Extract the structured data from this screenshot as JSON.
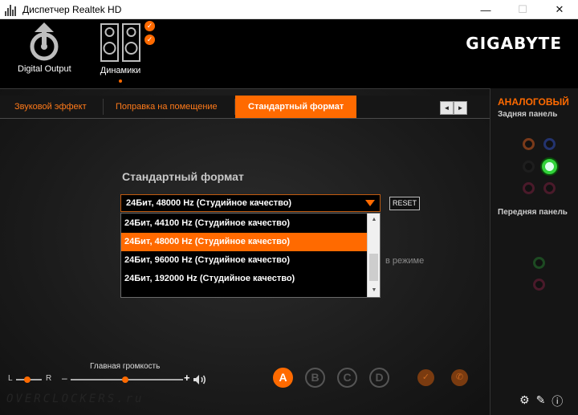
{
  "window": {
    "title": "Диспетчер Realtek HD",
    "minimize": "—",
    "maximize": "☐",
    "close": "✕"
  },
  "header": {
    "devices": [
      {
        "label": "Digital Output",
        "icon": "digital-output-icon"
      },
      {
        "label": "Динамики",
        "icon": "speakers-icon",
        "active": true
      }
    ],
    "brand": "GIGABYTE",
    "badges": [
      "✓",
      "✓"
    ]
  },
  "tabs": [
    {
      "label": "Звуковой эффект"
    },
    {
      "label": "Поправка на помещение"
    },
    {
      "label": "Стандартный формат",
      "active": true
    }
  ],
  "tab_scroll": {
    "left": "◄",
    "right": "►"
  },
  "format": {
    "title": "Стандартный формат",
    "selected": "24Бит, 48000 Hz (Студийное качество)",
    "reset_label": "RESET",
    "options": [
      "24Бит, 44100 Hz (Студийное качество)",
      "24Бит, 48000 Hz (Студийное качество)",
      "24Бит, 96000 Hz (Студийное качество)",
      "24Бит, 192000 Hz (Студийное качество)"
    ],
    "behind_text": "в режиме",
    "scroll_up": "▲",
    "scroll_down": "▼"
  },
  "volume": {
    "title": "Главная громкость",
    "left": "L",
    "right": "R",
    "minus": "–",
    "plus": "+",
    "balance": 0.5,
    "level": 0.5
  },
  "profiles": [
    "A",
    "B",
    "C",
    "D"
  ],
  "active_profile": "A",
  "watermark": "OVERCLOCKERS.ru",
  "right_panel": {
    "title": "АНАЛОГОВЫЙ",
    "rear": "Задняя панель",
    "front": "Передняя панель"
  },
  "colors": {
    "accent": "#ff6a00",
    "active_jack": "#32d23a"
  }
}
